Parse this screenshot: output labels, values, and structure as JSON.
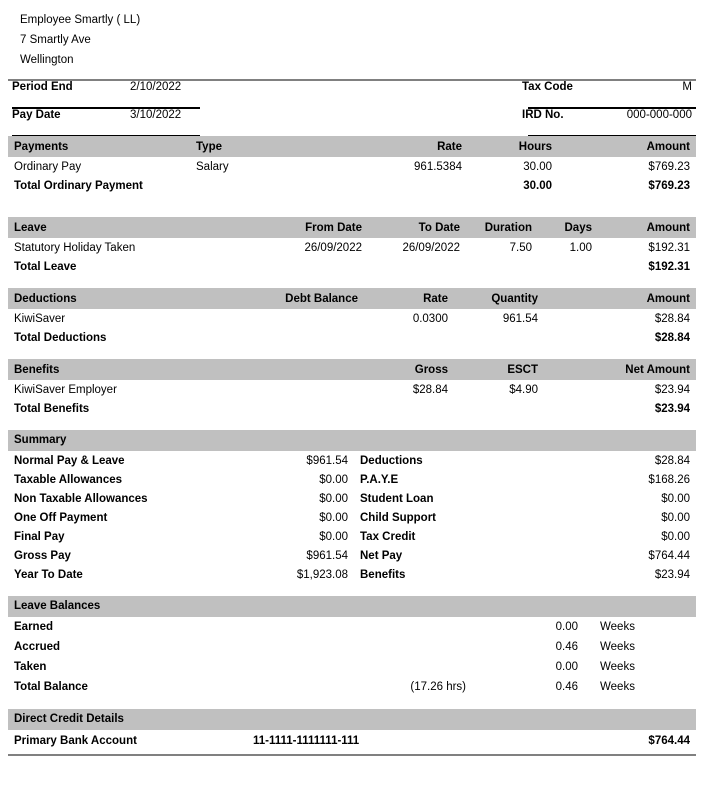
{
  "employer": {
    "name": "Employee Smartly ( LL)",
    "street": "7 Smartly Ave",
    "city": "Wellington"
  },
  "meta": {
    "period_end_label": "Period End",
    "period_end_value": "2/10/2022",
    "pay_date_label": "Pay Date",
    "pay_date_value": "3/10/2022",
    "tax_code_label": "Tax Code",
    "tax_code_value": "M",
    "ird_label": "IRD No.",
    "ird_value": "000-000-000"
  },
  "payments": {
    "headers": [
      "Payments",
      "Type",
      "Rate",
      "Hours",
      "Amount"
    ],
    "rows": [
      {
        "name": "Ordinary Pay",
        "type": "Salary",
        "rate": "961.5384",
        "hours": "30.00",
        "amount": "$769.23"
      }
    ],
    "total": {
      "label": "Total Ordinary Payment",
      "type": "",
      "rate": "",
      "hours": "30.00",
      "amount": "$769.23"
    }
  },
  "leave": {
    "headers": [
      "Leave",
      "From Date",
      "To Date",
      "Duration",
      "Days",
      "Amount"
    ],
    "rows": [
      {
        "name": "Statutory Holiday Taken",
        "from": "26/09/2022",
        "to": "26/09/2022",
        "duration": "7.50",
        "days": "1.00",
        "amount": "$192.31"
      }
    ],
    "total": {
      "label": "Total Leave",
      "from": "",
      "to": "",
      "duration": "",
      "days": "",
      "amount": "$192.31"
    }
  },
  "deductions": {
    "headers": [
      "Deductions",
      "Debt Balance",
      "Rate",
      "Quantity",
      "Amount"
    ],
    "rows": [
      {
        "name": "KiwiSaver",
        "debt": "",
        "rate": "0.0300",
        "quantity": "961.54",
        "amount": "$28.84"
      }
    ],
    "total": {
      "label": "Total Deductions",
      "debt": "",
      "rate": "",
      "quantity": "",
      "amount": "$28.84"
    }
  },
  "benefits": {
    "headers": [
      "Benefits",
      "Gross",
      "ESCT",
      "Net Amount"
    ],
    "rows": [
      {
        "name": "KiwiSaver Employer",
        "gross": "$28.84",
        "esct": "$4.90",
        "net": "$23.94"
      }
    ],
    "total": {
      "label": "Total Benefits",
      "gross": "",
      "esct": "",
      "net": "$23.94"
    }
  },
  "summary": {
    "title": "Summary",
    "left": [
      {
        "label": "Normal Pay & Leave",
        "value": "$961.54"
      },
      {
        "label": "Taxable Allowances",
        "value": "$0.00"
      },
      {
        "label": "Non Taxable Allowances",
        "value": "$0.00"
      },
      {
        "label": "One Off Payment",
        "value": "$0.00"
      },
      {
        "label": "Final Pay",
        "value": "$0.00"
      },
      {
        "label": "Gross Pay",
        "value": "$961.54"
      },
      {
        "label": "Year To Date",
        "value": "$1,923.08"
      }
    ],
    "right": [
      {
        "label": "Deductions",
        "value": "$28.84"
      },
      {
        "label": "P.A.Y.E",
        "value": "$168.26"
      },
      {
        "label": "Student Loan",
        "value": "$0.00"
      },
      {
        "label": "Child Support",
        "value": "$0.00"
      },
      {
        "label": "Tax Credit",
        "value": "$0.00"
      },
      {
        "label": "Net Pay",
        "value": "$764.44"
      },
      {
        "label": "Benefits",
        "value": "$23.94"
      }
    ]
  },
  "leave_balances": {
    "title": "Leave Balances",
    "rows": [
      {
        "label": "Earned",
        "note": "",
        "value": "0.00",
        "unit": "Weeks"
      },
      {
        "label": "Accrued",
        "note": "",
        "value": "0.46",
        "unit": "Weeks"
      },
      {
        "label": "Taken",
        "note": "",
        "value": "0.00",
        "unit": "Weeks"
      },
      {
        "label": "Total Balance",
        "note": "(17.26 hrs)",
        "value": "0.46",
        "unit": "Weeks"
      }
    ]
  },
  "direct_credit": {
    "title": "Direct Credit Details",
    "rows": [
      {
        "label": "Primary Bank Account",
        "account": "11-1111-1111111-111",
        "amount": "$764.44"
      }
    ]
  },
  "colors": {
    "header_gray": "#c0c0c0",
    "rule_gray": "#808080",
    "text": "#000000"
  }
}
